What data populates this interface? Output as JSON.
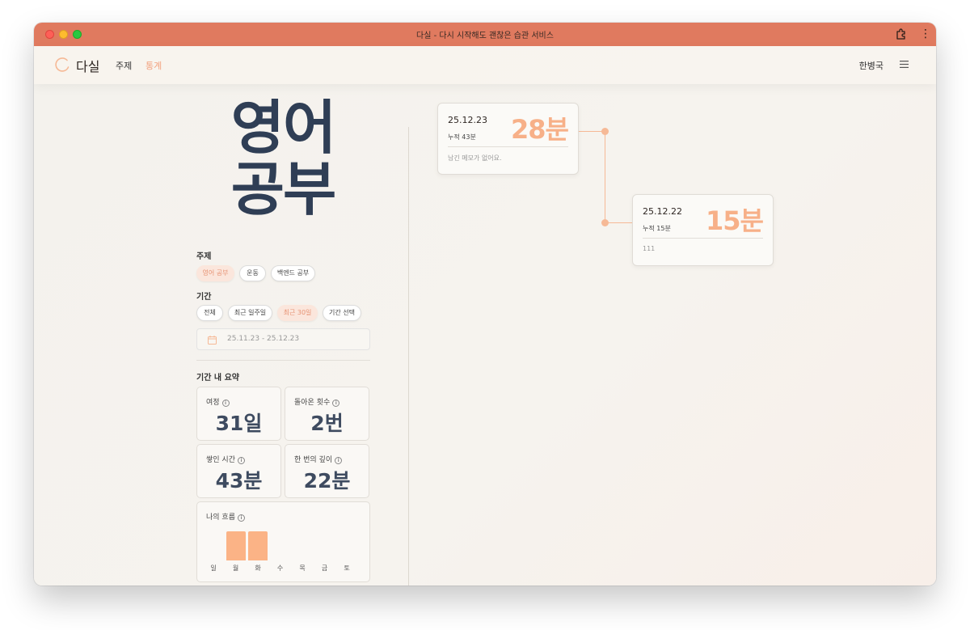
{
  "window": {
    "title": "다실 - 다시 시작해도 괜찮은 습관 서비스"
  },
  "nav": {
    "logo_text": "다실",
    "items": [
      {
        "label": "주제",
        "active": false
      },
      {
        "label": "통계",
        "active": true
      }
    ],
    "user_name": "한병국"
  },
  "title": {
    "line1": "영어",
    "line2": "공부"
  },
  "topic": {
    "label": "주제",
    "chips": [
      {
        "label": "영어 공부",
        "active": true
      },
      {
        "label": "운동",
        "active": false
      },
      {
        "label": "백엔드 공부",
        "active": false
      }
    ]
  },
  "period": {
    "label": "기간",
    "chips": [
      {
        "label": "전체",
        "active": false
      },
      {
        "label": "최근 일주일",
        "active": false
      },
      {
        "label": "최근 30일",
        "active": true
      },
      {
        "label": "기간 선택",
        "active": false
      }
    ],
    "range": "25.11.23 - 25.12.23"
  },
  "summary": {
    "label": "기간 내 요약",
    "cards": [
      {
        "label": "여정",
        "value": "31일"
      },
      {
        "label": "돌아온 횟수",
        "value": "2번"
      },
      {
        "label": "쌓인 시간",
        "value": "43분"
      },
      {
        "label": "한 번의 깊이",
        "value": "22분"
      }
    ],
    "flow": {
      "label": "나의 흐름",
      "days": [
        "일",
        "월",
        "화",
        "수",
        "목",
        "금",
        "토"
      ],
      "active_days": [
        1,
        2
      ]
    }
  },
  "timeline": [
    {
      "date": "25.12.23",
      "cumulative": "누적 43분",
      "minutes": "28분",
      "memo": "남긴 메모가 없어요."
    },
    {
      "date": "25.12.22",
      "cumulative": "누적 15분",
      "minutes": "15분",
      "memo": "111"
    }
  ],
  "colors": {
    "accent": "#f7b088",
    "titlebar": "#e07a5f",
    "title_text": "#2f3e55"
  }
}
